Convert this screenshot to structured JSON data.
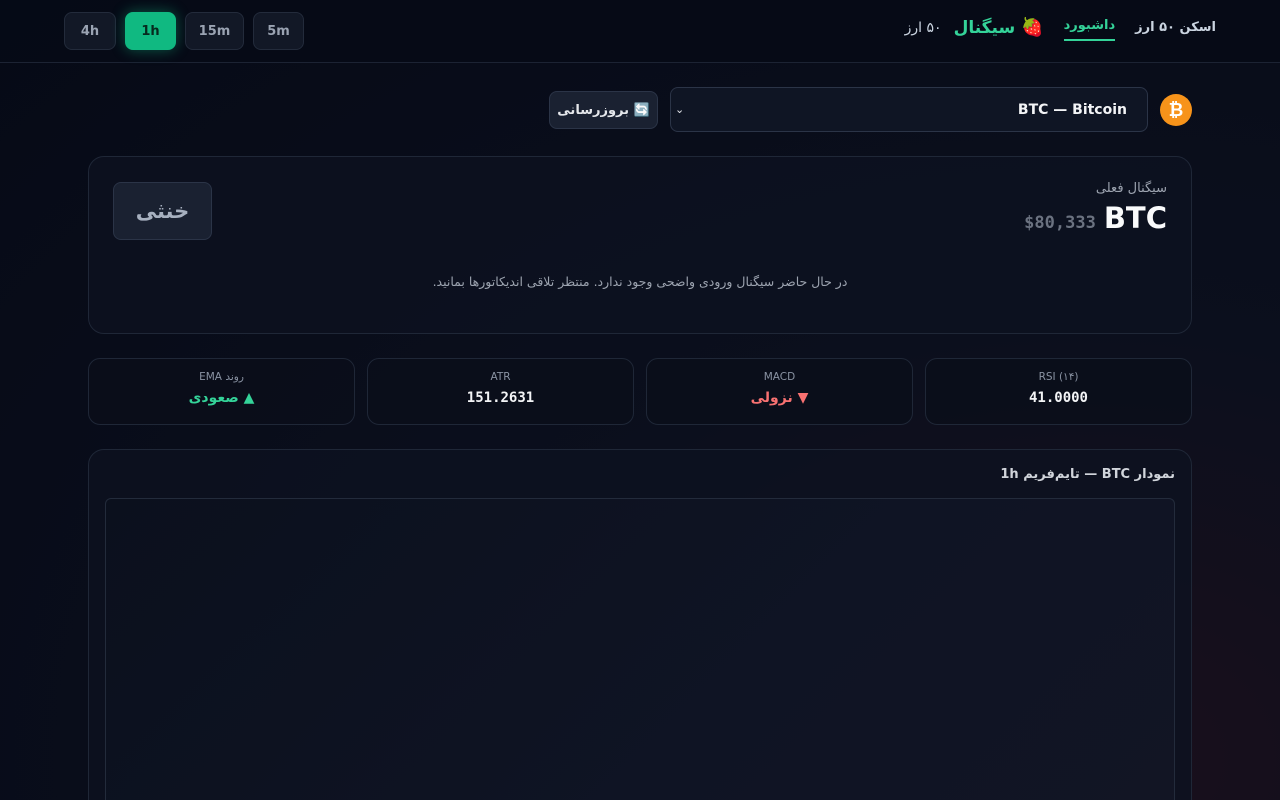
{
  "header": {
    "brand_icon": "🍓",
    "brand_title": "سیگنال",
    "brand_sub": "۵۰ ارز",
    "nav": [
      {
        "label": "داشبورد",
        "active": true
      },
      {
        "label": "اسکن ۵۰ ارز",
        "active": false
      }
    ],
    "timeframes": [
      {
        "label": "4h",
        "active": false
      },
      {
        "label": "1h",
        "active": true
      },
      {
        "label": "15m",
        "active": false
      },
      {
        "label": "5m",
        "active": false
      }
    ]
  },
  "selector": {
    "coin_icon": "₿",
    "selected": "BTC — Bitcoin",
    "refresh_label": "🔄 بروزرسانی"
  },
  "signal": {
    "label": "سیگنال فعلی",
    "symbol": "BTC",
    "price": "$80,333",
    "state": "خنثی",
    "message": "در حال حاضر سیگنال ورودی واضحی وجود ندارد. منتظر تلاقی اندیکاتورها بمانید."
  },
  "indicators": [
    {
      "label": "RSI (۱۴)",
      "value": "41.0000",
      "trend": "neutral"
    },
    {
      "label": "MACD",
      "value": "▼ نزولی",
      "trend": "down"
    },
    {
      "label": "ATR",
      "value": "151.2631",
      "trend": "neutral"
    },
    {
      "label": "روند EMA",
      "value": "▲ صعودی",
      "trend": "up"
    }
  ],
  "chart": {
    "title": "نمودار BTC — تایم‌فریم 1h"
  },
  "colors": {
    "accent": "#10b981",
    "bearish": "#f87171",
    "bullish": "#34d399",
    "bitcoin": "#f7931a"
  }
}
